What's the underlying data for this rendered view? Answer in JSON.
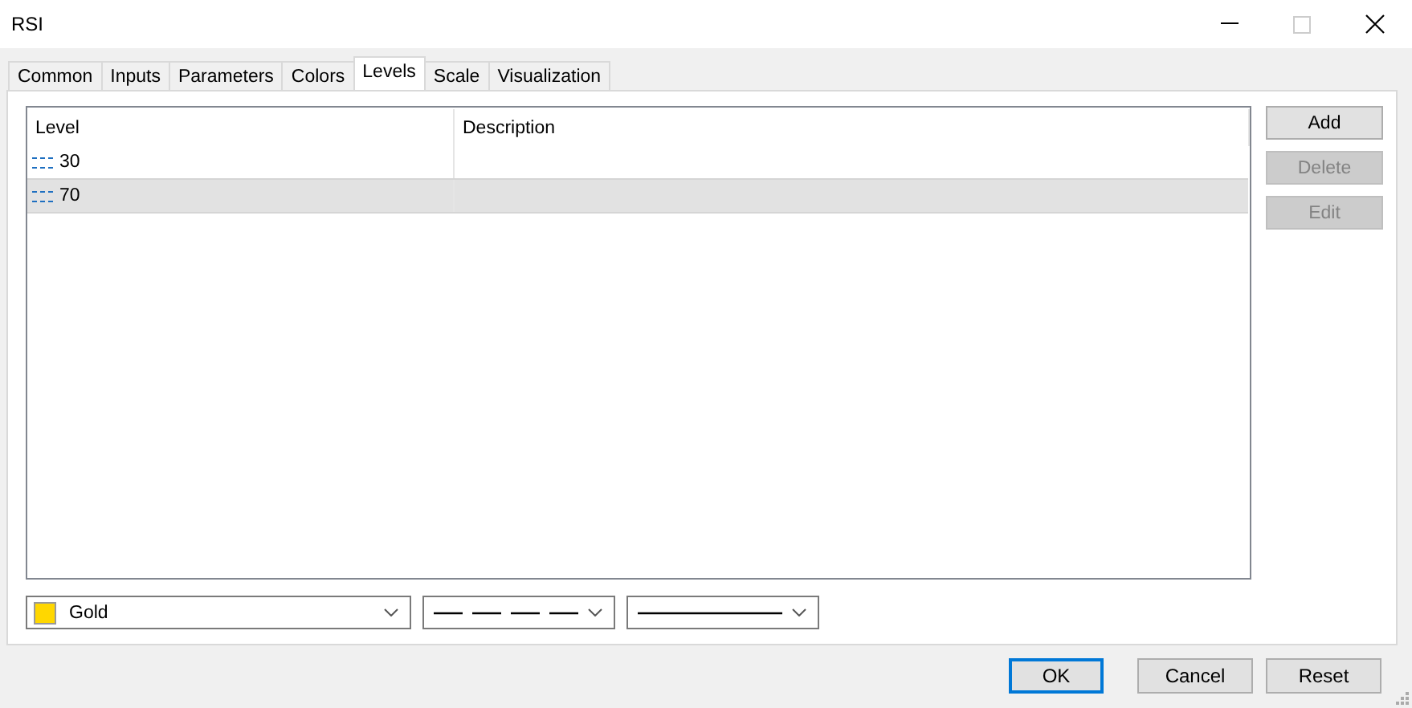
{
  "window": {
    "title": "RSI"
  },
  "tabs": [
    {
      "label": "Common",
      "selected": false
    },
    {
      "label": "Inputs",
      "selected": false
    },
    {
      "label": "Parameters",
      "selected": false
    },
    {
      "label": "Colors",
      "selected": false
    },
    {
      "label": "Levels",
      "selected": true
    },
    {
      "label": "Scale",
      "selected": false
    },
    {
      "label": "Visualization",
      "selected": false
    }
  ],
  "table": {
    "columns": [
      "Level",
      "Description"
    ],
    "rows": [
      {
        "level": "30",
        "selected": false
      },
      {
        "level": "70",
        "selected": true
      }
    ]
  },
  "side_buttons": [
    {
      "label": "Add",
      "disabled": false
    },
    {
      "label": "Delete",
      "disabled": true
    },
    {
      "label": "Edit",
      "disabled": true
    }
  ],
  "style_pickers": [
    {
      "kind": "color",
      "label": "Gold",
      "color": "#ffd700"
    },
    {
      "kind": "dashed-line"
    },
    {
      "kind": "solid-line"
    }
  ],
  "footer_buttons": [
    {
      "label": "OK",
      "default": true
    },
    {
      "label": "Cancel",
      "default": false
    },
    {
      "label": "Reset",
      "default": false
    }
  ]
}
